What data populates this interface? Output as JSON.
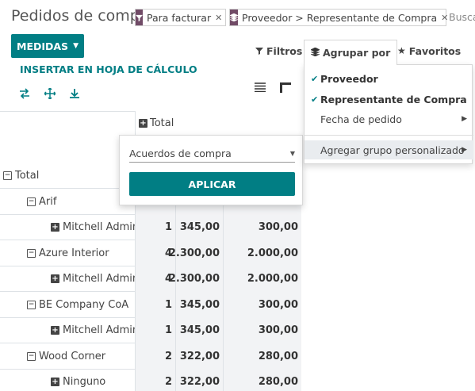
{
  "header": {
    "title": "Pedidos de compra",
    "facets": [
      {
        "icon": "filter-icon",
        "label": "Para facturar"
      },
      {
        "icon": "layers-icon",
        "label": "Proveedor > Representante de Compra"
      }
    ],
    "search_placeholder": "Buscar..."
  },
  "toolbar": {
    "measures_label": "MEDIDAS",
    "insert_label": "INSERTAR EN HOJA DE CÁLCULO",
    "filters_label": "Filtros",
    "groupby_label": "Agrupar por",
    "favorites_label": "Favoritos"
  },
  "pivot": {
    "col_header": "Total",
    "rows": [
      {
        "label": "Total",
        "level": 0,
        "expand": "minus",
        "c1": "",
        "c2": "",
        "c3": ""
      },
      {
        "label": "Arif",
        "level": 1,
        "expand": "minus",
        "c1": "",
        "c2": "",
        "c3": ""
      },
      {
        "label": "Mitchell Admin",
        "level": 2,
        "expand": "plus",
        "c1": "1",
        "c2": "345,00",
        "c3": "300,00"
      },
      {
        "label": "Azure Interior",
        "level": 1,
        "expand": "minus",
        "c1": "4",
        "c2": "2.300,00",
        "c3": "2.000,00"
      },
      {
        "label": "Mitchell Admin",
        "level": 2,
        "expand": "plus",
        "c1": "4",
        "c2": "2.300,00",
        "c3": "2.000,00"
      },
      {
        "label": "BE Company CoA",
        "level": 1,
        "expand": "minus",
        "c1": "1",
        "c2": "345,00",
        "c3": "300,00"
      },
      {
        "label": "Mitchell Admin",
        "level": 2,
        "expand": "plus",
        "c1": "1",
        "c2": "345,00",
        "c3": "300,00"
      },
      {
        "label": "Wood Corner",
        "level": 1,
        "expand": "minus",
        "c1": "2",
        "c2": "322,00",
        "c3": "280,00"
      },
      {
        "label": "Ninguno",
        "level": 2,
        "expand": "plus",
        "c1": "2",
        "c2": "322,00",
        "c3": "280,00"
      }
    ]
  },
  "measure_popup": {
    "selected": "Acuerdos de compra",
    "apply_label": "APLICAR"
  },
  "groupby_menu": {
    "items": [
      {
        "label": "Proveedor",
        "checked": true
      },
      {
        "label": "Representante de Compra",
        "checked": true
      },
      {
        "label": "Fecha de pedido",
        "checked": false,
        "submenu": true
      }
    ],
    "custom_label": "Agregar grupo personalizado"
  },
  "colors": {
    "primary": "#017E84",
    "facet": "#714B67"
  }
}
